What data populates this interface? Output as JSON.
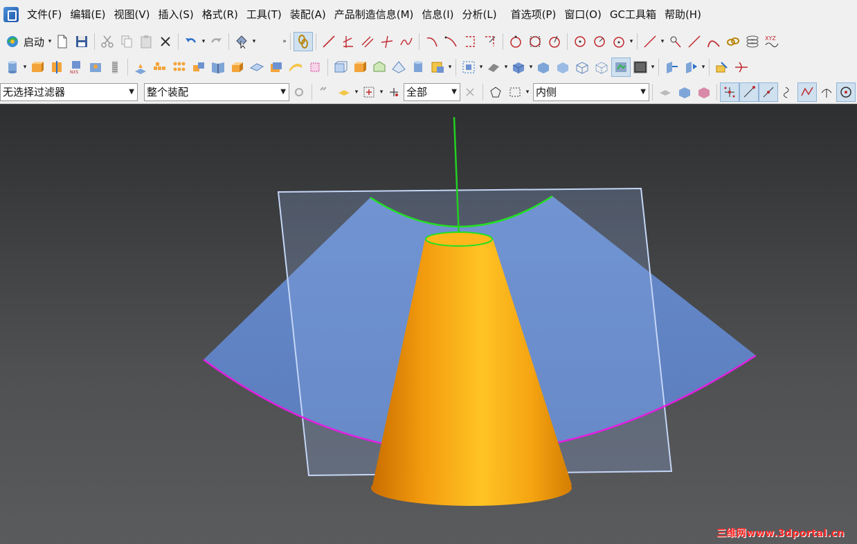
{
  "menubar": {
    "items": [
      "文件(F)",
      "编辑(E)",
      "视图(V)",
      "插入(S)",
      "格式(R)",
      "工具(T)",
      "装配(A)",
      "产品制造信息(M)",
      "信息(I)",
      "分析(L)",
      "首选项(P)",
      "窗口(O)",
      "GC工具箱",
      "帮助(H)"
    ]
  },
  "toolbar1": {
    "start_label": "启动"
  },
  "selectionbar": {
    "filter_value": "无选择过滤器",
    "scope_value": "整个装配",
    "type_value": "全部",
    "mode_value": "内侧"
  },
  "colors": {
    "cone_light": "#ffb81c",
    "cone_dark": "#d97a00",
    "sheet": "#6f91d1",
    "frame": "#b9ccf2",
    "edge_top": "#21d621",
    "edge_bottom": "#e020e0"
  },
  "watermark": {
    "text": "三维网www.3dportal.cn"
  },
  "icons": [
    "app-logo-icon",
    "start-icon",
    "new-file-icon",
    "save-icon",
    "cut-icon",
    "copy-icon",
    "paste-icon",
    "delete-icon",
    "undo-icon",
    "redo-icon",
    "select-icon",
    "snap-icon",
    "line-icon",
    "curve-icon",
    "circle-icon",
    "cylinder-icon",
    "block-icon",
    "view-icon",
    "snap-point-icon"
  ]
}
